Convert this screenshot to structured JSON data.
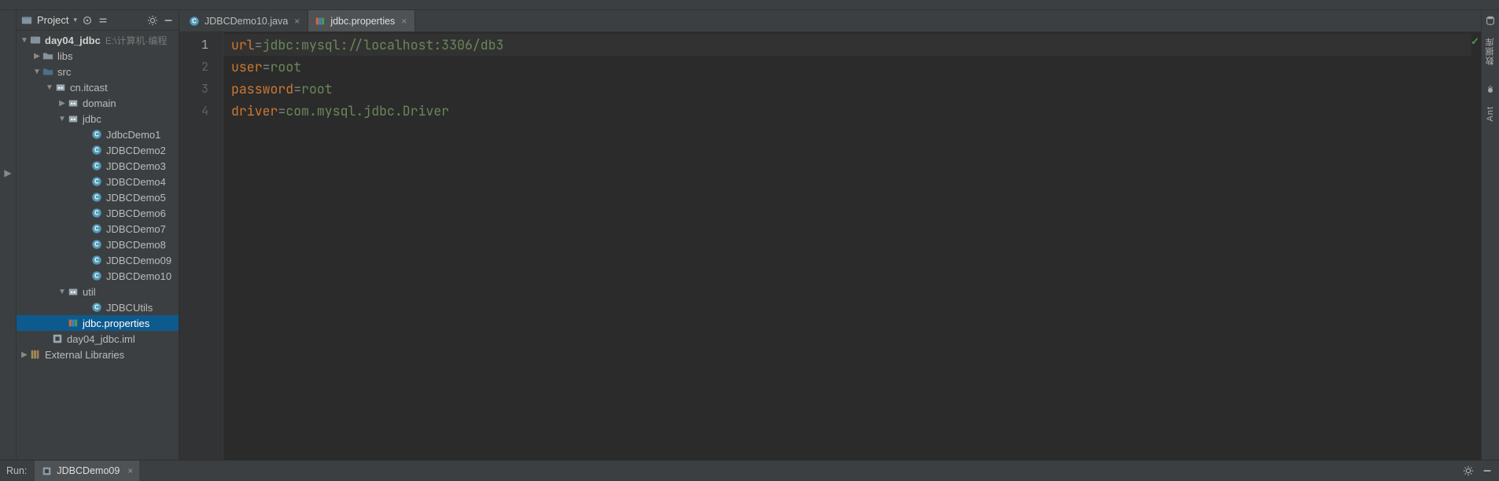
{
  "project_panel": {
    "title": "Project",
    "root_module": {
      "name": "day04_jdbc",
      "path_hint": "E:\\计算机·编程"
    },
    "tree": {
      "libs": "libs",
      "src": "src",
      "pkg_root": "cn.itcast",
      "pkg_domain": "domain",
      "pkg_jdbc": "jdbc",
      "files_jdbc": [
        "JdbcDemo1",
        "JDBCDemo2",
        "JDBCDemo3",
        "JDBCDemo4",
        "JDBCDemo5",
        "JDBCDemo6",
        "JDBCDemo7",
        "JDBCDemo8",
        "JDBCDemo09",
        "JDBCDemo10"
      ],
      "pkg_util": "util",
      "files_util": [
        "JDBCUtils"
      ],
      "file_properties": "jdbc.properties",
      "file_iml": "day04_jdbc.iml",
      "external_libs": "External Libraries"
    }
  },
  "editor": {
    "tabs": [
      {
        "label": "JDBCDemo10.java",
        "active": false,
        "icon": "java"
      },
      {
        "label": "jdbc.properties",
        "active": true,
        "icon": "properties"
      }
    ],
    "code_lines": [
      {
        "n": "1",
        "key": "url",
        "value": "jdbc:mysql://localhost:3306/db3"
      },
      {
        "n": "2",
        "key": "user",
        "value": "root"
      },
      {
        "n": "3",
        "key": "password",
        "value": "root"
      },
      {
        "n": "4",
        "key": "driver",
        "value": "com.mysql.jdbc.Driver"
      }
    ],
    "status_ok": "✓"
  },
  "bottom": {
    "label": "Run:",
    "tab": "JDBCDemo09"
  },
  "right_rail": {
    "database": "数据库",
    "ant": "Ant"
  }
}
